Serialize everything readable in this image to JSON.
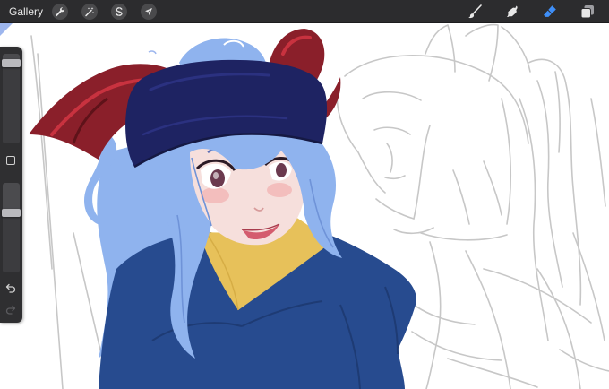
{
  "toolbar": {
    "gallery_label": "Gallery",
    "left_tools": [
      {
        "icon": "wrench-icon",
        "name": "actions-button"
      },
      {
        "icon": "magic-wand-icon",
        "name": "adjustments-button"
      },
      {
        "icon": "selection-s-icon",
        "name": "selection-button"
      },
      {
        "icon": "arrow-cursor-icon",
        "name": "transform-button"
      }
    ],
    "right_tools": [
      {
        "icon": "brush-icon",
        "name": "brush-tool-button",
        "active": false
      },
      {
        "icon": "smudge-icon",
        "name": "smudge-tool-button",
        "active": false
      },
      {
        "icon": "eraser-icon",
        "name": "eraser-tool-button",
        "active": true
      },
      {
        "icon": "layers-icon",
        "name": "layers-button",
        "active": false
      }
    ]
  },
  "sidebar": {
    "brush_size_level": 0.93,
    "opacity_level": 0.68
  },
  "colors": {
    "toolbar_bg": "#2c2c2e",
    "active_tool": "#3e8ef7",
    "icon_inactive": "#e8e8e8",
    "hair": "#8fb3ee",
    "hat": "#1e2362",
    "horns": "#8a1f2a",
    "sweater": "#274b8f",
    "collar": "#e7c15a",
    "skin": "#f6dfdc",
    "sketch_line": "#c4c4c4"
  }
}
